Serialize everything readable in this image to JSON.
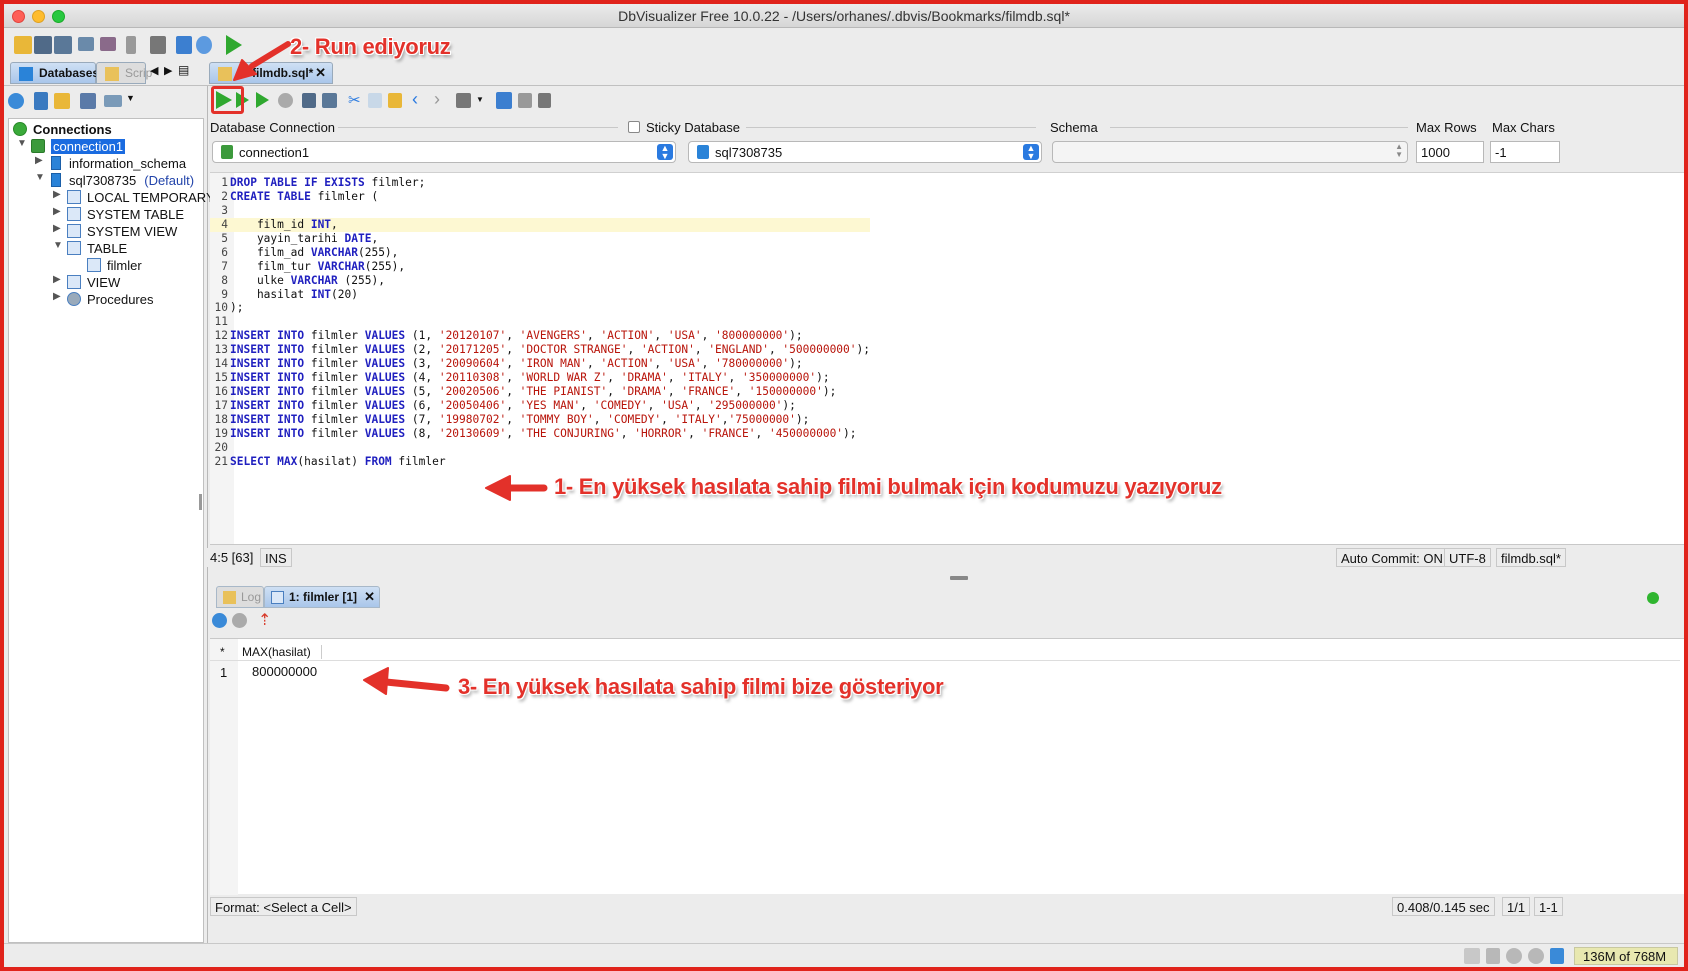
{
  "window": {
    "title": "DbVisualizer Free 10.0.22 - /Users/orhanes/.dbvis/Bookmarks/filmdb.sql*"
  },
  "tabs": {
    "databases": "Databases",
    "scripts": "Scrip",
    "editor_tab": "1: filmdb.sql*"
  },
  "tree": {
    "root": "Connections",
    "connection": "connection1",
    "schema1": "information_schema",
    "schema2": "sql7308735",
    "schema2_tag": "(Default)",
    "items": [
      "LOCAL TEMPORARY",
      "SYSTEM TABLE",
      "SYSTEM VIEW",
      "TABLE",
      "filmler",
      "VIEW",
      "Procedures"
    ]
  },
  "connbar": {
    "db_connection_label": "Database Connection",
    "sticky_label": "Sticky Database",
    "schema_label": "Schema",
    "max_rows_label": "Max Rows",
    "max_chars_label": "Max Chars",
    "connection_value": "connection1",
    "database_value": "sql7308735",
    "schema_value": "",
    "max_rows_value": "1000",
    "max_chars_value": "-1"
  },
  "editor": {
    "lines": [
      [
        [
          "kw",
          "DROP TABLE IF EXISTS"
        ],
        [
          "t",
          " filmler;"
        ]
      ],
      [
        [
          "kw",
          "CREATE TABLE"
        ],
        [
          "t",
          " filmler ("
        ]
      ],
      [
        [
          "t",
          ""
        ]
      ],
      [
        [
          "t",
          "    film_id "
        ],
        [
          "kw",
          "INT"
        ],
        [
          "t",
          ","
        ]
      ],
      [
        [
          "t",
          "    yayin_tarihi "
        ],
        [
          "kw",
          "DATE"
        ],
        [
          "t",
          ","
        ]
      ],
      [
        [
          "t",
          "    film_ad "
        ],
        [
          "kw",
          "VARCHAR"
        ],
        [
          "t",
          "(255),"
        ]
      ],
      [
        [
          "t",
          "    film_tur "
        ],
        [
          "kw",
          "VARCHAR"
        ],
        [
          "t",
          "(255),"
        ]
      ],
      [
        [
          "t",
          "    ulke "
        ],
        [
          "kw",
          "VARCHAR"
        ],
        [
          "t",
          " (255),"
        ]
      ],
      [
        [
          "t",
          "    hasilat "
        ],
        [
          "kw",
          "INT"
        ],
        [
          "t",
          "(20)"
        ]
      ],
      [
        [
          "t",
          ");"
        ]
      ],
      [
        [
          "t",
          ""
        ]
      ],
      [
        [
          "kw",
          "INSERT INTO"
        ],
        [
          "t",
          " filmler "
        ],
        [
          "kw",
          "VALUES"
        ],
        [
          "t",
          " (1, "
        ],
        [
          "s",
          "'20120107'"
        ],
        [
          "t",
          ", "
        ],
        [
          "s",
          "'AVENGERS'"
        ],
        [
          "t",
          ", "
        ],
        [
          "s",
          "'ACTION'"
        ],
        [
          "t",
          ", "
        ],
        [
          "s",
          "'USA'"
        ],
        [
          "t",
          ", "
        ],
        [
          "s",
          "'800000000'"
        ],
        [
          "t",
          ");"
        ]
      ],
      [
        [
          "kw",
          "INSERT INTO"
        ],
        [
          "t",
          " filmler "
        ],
        [
          "kw",
          "VALUES"
        ],
        [
          "t",
          " (2, "
        ],
        [
          "s",
          "'20171205'"
        ],
        [
          "t",
          ", "
        ],
        [
          "s",
          "'DOCTOR STRANGE'"
        ],
        [
          "t",
          ", "
        ],
        [
          "s",
          "'ACTION'"
        ],
        [
          "t",
          ", "
        ],
        [
          "s",
          "'ENGLAND'"
        ],
        [
          "t",
          ", "
        ],
        [
          "s",
          "'500000000'"
        ],
        [
          "t",
          ");"
        ]
      ],
      [
        [
          "kw",
          "INSERT INTO"
        ],
        [
          "t",
          " filmler "
        ],
        [
          "kw",
          "VALUES"
        ],
        [
          "t",
          " (3, "
        ],
        [
          "s",
          "'20090604'"
        ],
        [
          "t",
          ", "
        ],
        [
          "s",
          "'IRON MAN'"
        ],
        [
          "t",
          ", "
        ],
        [
          "s",
          "'ACTION'"
        ],
        [
          "t",
          ", "
        ],
        [
          "s",
          "'USA'"
        ],
        [
          "t",
          ", "
        ],
        [
          "s",
          "'780000000'"
        ],
        [
          "t",
          ");"
        ]
      ],
      [
        [
          "kw",
          "INSERT INTO"
        ],
        [
          "t",
          " filmler "
        ],
        [
          "kw",
          "VALUES"
        ],
        [
          "t",
          " (4, "
        ],
        [
          "s",
          "'20110308'"
        ],
        [
          "t",
          ", "
        ],
        [
          "s",
          "'WORLD WAR Z'"
        ],
        [
          "t",
          ", "
        ],
        [
          "s",
          "'DRAMA'"
        ],
        [
          "t",
          ", "
        ],
        [
          "s",
          "'ITALY'"
        ],
        [
          "t",
          ", "
        ],
        [
          "s",
          "'350000000'"
        ],
        [
          "t",
          ");"
        ]
      ],
      [
        [
          "kw",
          "INSERT INTO"
        ],
        [
          "t",
          " filmler "
        ],
        [
          "kw",
          "VALUES"
        ],
        [
          "t",
          " (5, "
        ],
        [
          "s",
          "'20020506'"
        ],
        [
          "t",
          ", "
        ],
        [
          "s",
          "'THE PIANIST'"
        ],
        [
          "t",
          ", "
        ],
        [
          "s",
          "'DRAMA'"
        ],
        [
          "t",
          ", "
        ],
        [
          "s",
          "'FRANCE'"
        ],
        [
          "t",
          ", "
        ],
        [
          "s",
          "'150000000'"
        ],
        [
          "t",
          ");"
        ]
      ],
      [
        [
          "kw",
          "INSERT INTO"
        ],
        [
          "t",
          " filmler "
        ],
        [
          "kw",
          "VALUES"
        ],
        [
          "t",
          " (6, "
        ],
        [
          "s",
          "'20050406'"
        ],
        [
          "t",
          ", "
        ],
        [
          "s",
          "'YES MAN'"
        ],
        [
          "t",
          ", "
        ],
        [
          "s",
          "'COMEDY'"
        ],
        [
          "t",
          ", "
        ],
        [
          "s",
          "'USA'"
        ],
        [
          "t",
          ", "
        ],
        [
          "s",
          "'295000000'"
        ],
        [
          "t",
          ");"
        ]
      ],
      [
        [
          "kw",
          "INSERT INTO"
        ],
        [
          "t",
          " filmler "
        ],
        [
          "kw",
          "VALUES"
        ],
        [
          "t",
          " (7, "
        ],
        [
          "s",
          "'19980702'"
        ],
        [
          "t",
          ", "
        ],
        [
          "s",
          "'TOMMY BOY'"
        ],
        [
          "t",
          ", "
        ],
        [
          "s",
          "'COMEDY'"
        ],
        [
          "t",
          ", "
        ],
        [
          "s",
          "'ITALY'"
        ],
        [
          "t",
          ","
        ],
        [
          "s",
          "'75000000'"
        ],
        [
          "t",
          ");"
        ]
      ],
      [
        [
          "kw",
          "INSERT INTO"
        ],
        [
          "t",
          " filmler "
        ],
        [
          "kw",
          "VALUES"
        ],
        [
          "t",
          " (8, "
        ],
        [
          "s",
          "'20130609'"
        ],
        [
          "t",
          ", "
        ],
        [
          "s",
          "'THE CONJURING'"
        ],
        [
          "t",
          ", "
        ],
        [
          "s",
          "'HORROR'"
        ],
        [
          "t",
          ", "
        ],
        [
          "s",
          "'FRANCE'"
        ],
        [
          "t",
          ", "
        ],
        [
          "s",
          "'450000000'"
        ],
        [
          "t",
          ");"
        ]
      ],
      [
        [
          "t",
          ""
        ]
      ],
      [
        [
          "kw",
          "SELECT MAX"
        ],
        [
          "t",
          "(hasilat) "
        ],
        [
          "kw",
          "FROM"
        ],
        [
          "t",
          " filmler"
        ]
      ]
    ]
  },
  "status": {
    "position": "4:5 [63]",
    "mode": "INS",
    "auto_commit": "Auto Commit: ON",
    "encoding": "UTF-8",
    "file": "filmdb.sql*"
  },
  "results": {
    "log_tab": "Log",
    "result_tab": "1: filmler [1]",
    "header_marker": "*",
    "column": "MAX(hasilat)",
    "row_number": "1",
    "value": "800000000",
    "format": "Format: <Select a Cell>",
    "timing": "0.408/0.145 sec",
    "rows": "1/1",
    "range": "1-1"
  },
  "memory": "136M of 768M",
  "annotations": {
    "step1": "1- En yüksek hasılata sahip filmi bulmak için kodumuzu yazıyoruz",
    "step2": "2- Run ediyoruz",
    "step3": "3- En yüksek hasılata sahip filmi bize gösteriyor"
  },
  "colors": {
    "annotation": "#e3312a",
    "keyword": "#1f1fbf",
    "string": "#b8140a",
    "selection": "#1a6be0"
  }
}
